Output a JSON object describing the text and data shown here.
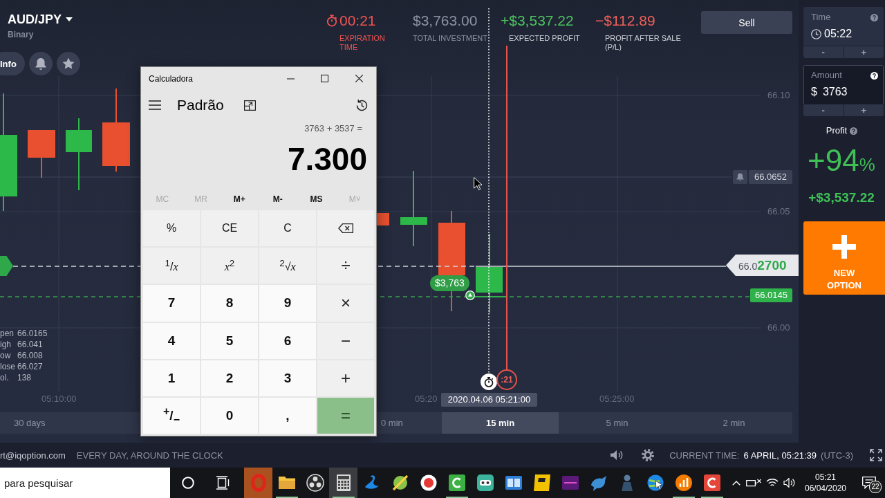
{
  "asset": {
    "symbol": "AUD/JPY",
    "type": "Binary"
  },
  "chart_tools": [
    {
      "kind": "info",
      "label": "Info"
    },
    {
      "kind": "alerts"
    },
    {
      "kind": "favorite"
    }
  ],
  "stats": [
    {
      "kind": "timer",
      "value": "00:21",
      "label": "EXPIRATION TIME",
      "color": "#ef5350"
    },
    {
      "kind": "amount",
      "value": "$3,763.00",
      "label": "TOTAL INVESTMENT",
      "color": "#8c92a3"
    },
    {
      "kind": "amount",
      "value": "+$3,537.22",
      "label": "EXPECTED PROFIT",
      "color": "#4cc35e"
    },
    {
      "kind": "amount",
      "value": "−$112.89",
      "label": "PROFIT AFTER SALE (P/L)",
      "color": "#f0605a"
    }
  ],
  "sell_button": {
    "label": "Sell"
  },
  "chart": {
    "price_axis": [
      "66.10",
      "66.05",
      "66.00"
    ],
    "time_axis": [
      "05:10:00",
      "05:20",
      "05:25:00"
    ],
    "alert_price": "66.0652",
    "current_price": "66.0**2700**",
    "strike_price": "66.0145",
    "position_amount": "$3,763",
    "countdown": ":21",
    "time_tooltip": "2020.04.06 05:21:00",
    "ohlc": [
      {
        "label": "pen",
        "value": "66.0165"
      },
      {
        "label": "igh",
        "value": "66.041"
      },
      {
        "label": "ow",
        "value": "66.008"
      },
      {
        "label": "lose",
        "value": "66.027"
      },
      {
        "label": "ol.",
        "value": "138"
      }
    ]
  },
  "timeframes": [
    {
      "label": "30 days",
      "selected": false
    },
    {
      "label": "0 min",
      "selected": false
    },
    {
      "label": "15 min",
      "selected": true
    },
    {
      "label": "5 min",
      "selected": false
    },
    {
      "label": "2 min",
      "selected": false
    }
  ],
  "side_panel": {
    "time": {
      "label": "Time",
      "value": "05:22",
      "decrease": "-",
      "increase": "+"
    },
    "amount": {
      "label": "Amount",
      "currency": "$",
      "value": "3763",
      "decrease": "-",
      "increase": "+"
    },
    "profit": {
      "label": "Profit",
      "percent": "+94",
      "percent_sign": "%",
      "amount": "+$3,537.22"
    },
    "new_option": {
      "label": "NEW OPTION"
    }
  },
  "status_bar": {
    "support_email": "rt@iqoption.com",
    "slogan": "EVERY DAY, AROUND THE CLOCK",
    "time_label": "CURRENT TIME:",
    "time": "6 APRIL, 05:21:39",
    "timezone": "(UTC-3)"
  },
  "calculator": {
    "title": "Calculadora",
    "mode": "Padrão",
    "expression": "3763 + 3537 =",
    "result": "7.300",
    "memory": [
      {
        "label": "MC",
        "disabled": true
      },
      {
        "label": "MR",
        "disabled": true
      },
      {
        "label": "M+",
        "disabled": false
      },
      {
        "label": "M-",
        "disabled": false
      },
      {
        "label": "MS",
        "disabled": false
      },
      {
        "label": "M˅",
        "disabled": true
      }
    ],
    "keys": [
      {
        "kind": "function",
        "label": "%"
      },
      {
        "kind": "function",
        "label": "CE"
      },
      {
        "kind": "function",
        "label": "C"
      },
      {
        "kind": "backspace"
      },
      {
        "kind": "function",
        "label": "$^{1}$/*x*"
      },
      {
        "kind": "function",
        "label": "*x*$^{2}$"
      },
      {
        "kind": "function",
        "label": "$^{2}$√*x*"
      },
      {
        "kind": "operator",
        "label": "÷"
      },
      {
        "kind": "digit",
        "label": "7"
      },
      {
        "kind": "digit",
        "label": "8"
      },
      {
        "kind": "digit",
        "label": "9"
      },
      {
        "kind": "operator",
        "label": "×"
      },
      {
        "kind": "digit",
        "label": "4"
      },
      {
        "kind": "digit",
        "label": "5"
      },
      {
        "kind": "digit",
        "label": "6"
      },
      {
        "kind": "operator",
        "label": "−"
      },
      {
        "kind": "digit",
        "label": "1"
      },
      {
        "kind": "digit",
        "label": "2"
      },
      {
        "kind": "digit",
        "label": "3"
      },
      {
        "kind": "operator",
        "label": "+"
      },
      {
        "kind": "digit",
        "label": "$^{+}$/$_{−}$"
      },
      {
        "kind": "digit",
        "label": "0"
      },
      {
        "kind": "digit",
        "label": ","
      },
      {
        "kind": "equals",
        "label": "="
      }
    ]
  },
  "taskbar": {
    "search": {
      "placeholder": "para pesquisar"
    },
    "apps": [
      {
        "running": false,
        "active": false,
        "attention": true
      },
      {
        "running": true,
        "active": false,
        "attention": false
      },
      {
        "running": false,
        "active": false,
        "attention": false
      },
      {
        "running": true,
        "active": true,
        "attention": false
      },
      {
        "running": false,
        "active": false,
        "attention": false
      },
      {
        "running": false,
        "active": false,
        "attention": false
      },
      {
        "running": false,
        "active": false,
        "attention": false
      },
      {
        "running": true,
        "active": false,
        "attention": false
      },
      {
        "running": false,
        "active": false,
        "attention": false
      },
      {
        "running": false,
        "active": false,
        "attention": false
      },
      {
        "running": false,
        "active": false,
        "attention": false
      },
      {
        "running": false,
        "active": false,
        "attention": false
      },
      {
        "running": false,
        "active": false,
        "attention": false
      },
      {
        "running": false,
        "active": false,
        "attention": false
      },
      {
        "running": false,
        "active": false,
        "attention": false
      },
      {
        "running": true,
        "active": false,
        "attention": false
      },
      {
        "running": true,
        "active": false,
        "attention": false
      }
    ],
    "clock": {
      "time": "05:21",
      "date": "06/04/2020"
    },
    "notification_count": "22"
  }
}
